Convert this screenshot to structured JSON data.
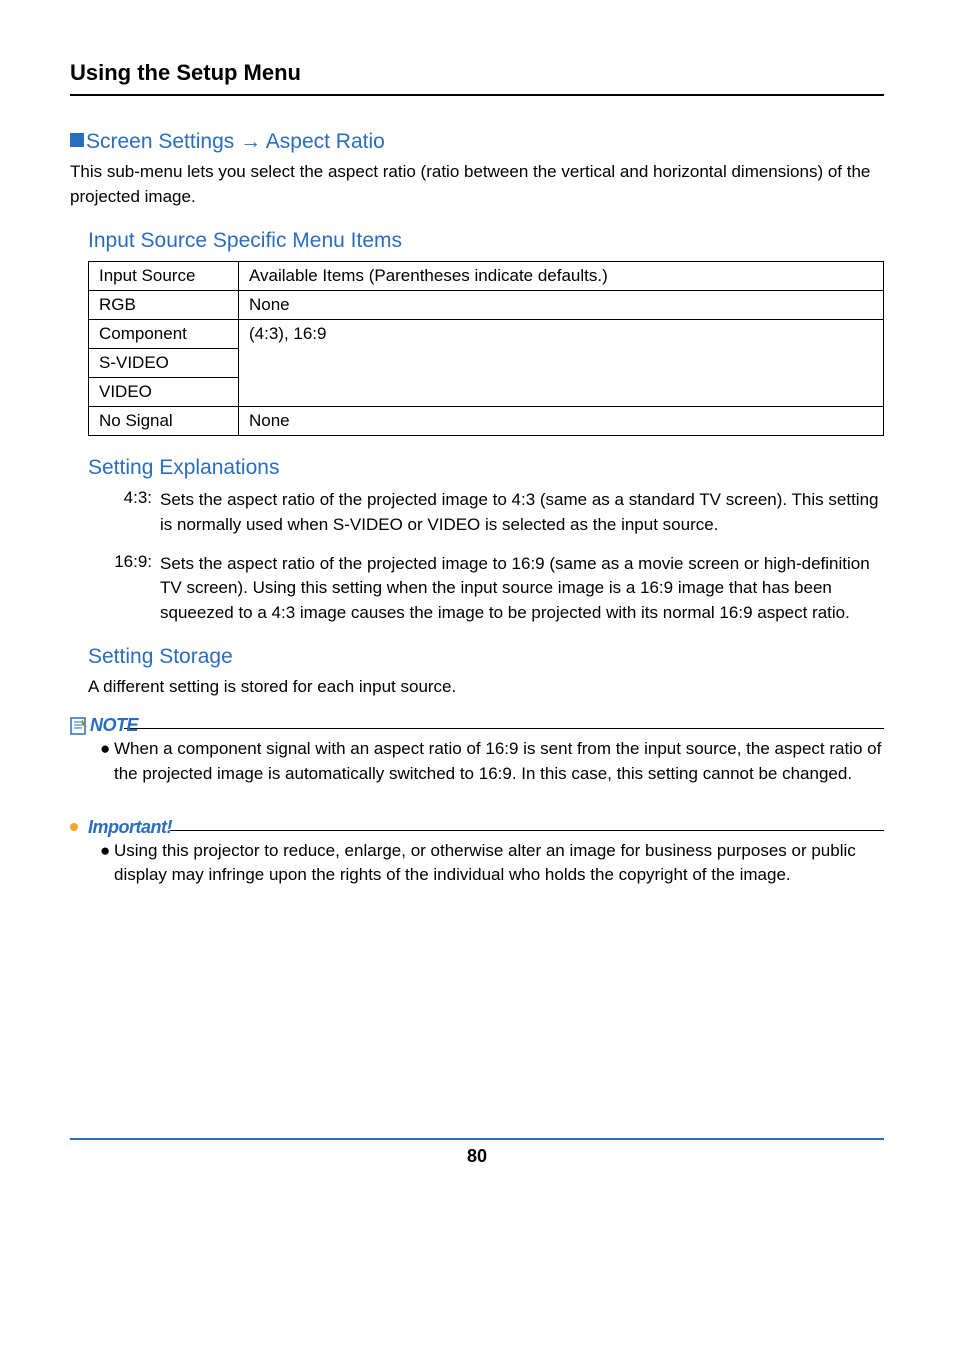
{
  "header": {
    "title": "Using the Setup Menu"
  },
  "section": {
    "title_prefix": "Screen Settings ",
    "arrow": "→",
    "title_suffix": " Aspect Ratio",
    "intro": "This sub-menu lets you select the aspect ratio (ratio between the vertical and horizontal dimensions) of the projected image."
  },
  "input_menu": {
    "title": "Input Source Specific Menu Items",
    "head_col1": "Input Source",
    "head_col2": "Available Items (Parentheses indicate defaults.)",
    "rows": {
      "rgb_label": "RGB",
      "rgb_val": "None",
      "component_label": "Component",
      "component_val": "(4:3), 16:9",
      "svideo_label": "S-VIDEO",
      "video_label": "VIDEO",
      "nosignal_label": "No Signal",
      "nosignal_val": "None"
    }
  },
  "explanations": {
    "title": "Setting Explanations",
    "r43_key": "4:3:",
    "r43_val": "Sets the aspect ratio of the projected image to 4:3 (same as a standard TV screen). This setting is normally used when S-VIDEO or VIDEO is selected as the input source.",
    "r169_key": "16:9:",
    "r169_val": "Sets the aspect ratio of the projected image to 16:9 (same as a movie screen or high-definition TV screen). Using this setting when the input source image is a 16:9 image that has been squeezed to a 4:3 image causes the image to be projected with its normal 16:9 aspect ratio."
  },
  "storage": {
    "title": "Setting Storage",
    "text": "A different setting is stored for each input source."
  },
  "note": {
    "label": "NOTE",
    "bullet": "When a component signal with an aspect ratio of 16:9 is sent from the input source, the aspect ratio of the projected image is automatically switched to 16:9. In this case, this setting cannot be changed."
  },
  "important": {
    "label": "Important!",
    "bullet": "Using this projector to reduce, enlarge, or otherwise alter an image for business purposes or public display may infringe upon the rights of the individual who holds the copyright of the image."
  },
  "footer": {
    "page": "80"
  }
}
